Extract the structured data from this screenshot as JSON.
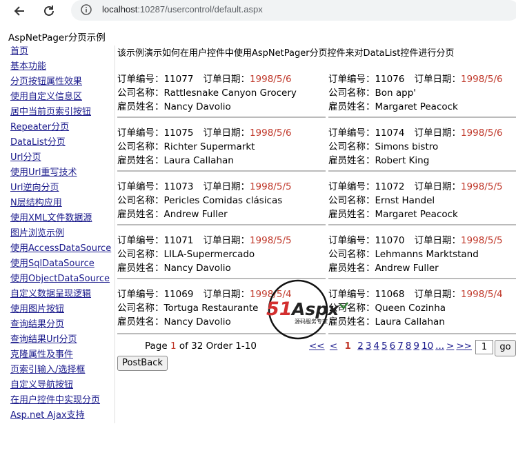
{
  "browser": {
    "url_host": "localhost",
    "url_path": ":10287/usercontrol/default.aspx"
  },
  "page_title": "AspNetPager分页示例",
  "sidebar": {
    "items": [
      {
        "label": "首页"
      },
      {
        "label": "基本功能"
      },
      {
        "label": "分页按钮属性效果"
      },
      {
        "label": "使用自定义信息区"
      },
      {
        "label": "居中当前页索引按钮"
      },
      {
        "label": "Repeater分页"
      },
      {
        "label": "DataList分页"
      },
      {
        "label": "Url分页"
      },
      {
        "label": "使用Url重写技术"
      },
      {
        "label": "Url逆向分页"
      },
      {
        "label": "N层结构应用"
      },
      {
        "label": "使用XML文件数据源"
      },
      {
        "label": "图片浏览示例"
      },
      {
        "label": "使用AccessDataSource"
      },
      {
        "label": "使用SqlDataSource"
      },
      {
        "label": "使用ObjectDataSource"
      },
      {
        "label": "自定义数据呈现逻辑"
      },
      {
        "label": "使用图片按钮"
      },
      {
        "label": "查询结果分页"
      },
      {
        "label": "查询结果Url分页"
      },
      {
        "label": "克隆属性及事件"
      },
      {
        "label": "页索引输入/选择框"
      },
      {
        "label": "自定义导航按钮"
      },
      {
        "label": "在用户控件中实现分页"
      },
      {
        "label": "Asp.net Ajax支持"
      }
    ]
  },
  "intro": "该示例演示如何在用户控件中使用AspNetPager分页控件来对DataList控件进行分页",
  "labels": {
    "order_no": "订单编号：",
    "order_date": "订单日期：",
    "company": "公司名称：",
    "employee": "雇员姓名："
  },
  "orders": [
    {
      "id": "11077",
      "date": "1998/5/6",
      "company": "Rattlesnake Canyon Grocery",
      "employee": "Nancy Davolio"
    },
    {
      "id": "11076",
      "date": "1998/5/6",
      "company": "Bon app'",
      "employee": "Margaret Peacock"
    },
    {
      "id": "11075",
      "date": "1998/5/6",
      "company": "Richter Supermarkt",
      "employee": "Laura Callahan"
    },
    {
      "id": "11074",
      "date": "1998/5/6",
      "company": "Simons bistro",
      "employee": "Robert King"
    },
    {
      "id": "11073",
      "date": "1998/5/5",
      "company": "Pericles Comidas clásicas",
      "employee": "Andrew Fuller"
    },
    {
      "id": "11072",
      "date": "1998/5/5",
      "company": "Ernst Handel",
      "employee": "Margaret Peacock"
    },
    {
      "id": "11071",
      "date": "1998/5/5",
      "company": "LILA-Supermercado",
      "employee": "Nancy Davolio"
    },
    {
      "id": "11070",
      "date": "1998/5/5",
      "company": "Lehmanns Marktstand",
      "employee": "Andrew Fuller"
    },
    {
      "id": "11069",
      "date": "1998/5/4",
      "company": "Tortuga Restaurante",
      "employee": "Nancy Davolio"
    },
    {
      "id": "11068",
      "date": "1998/5/4",
      "company": "Queen Cozinha",
      "employee": "Laura Callahan"
    }
  ],
  "pager": {
    "info_prefix": "Page ",
    "current_page": "1",
    "info_mid": " of 32  Order 1-10",
    "first": "<<",
    "prev": "<",
    "pages": [
      "2",
      "3",
      "4",
      "5",
      "6",
      "7",
      "8",
      "9",
      "10"
    ],
    "ellipsis": "...",
    "next": ">",
    "last": ">>",
    "input_value": "1",
    "go_label": "go"
  },
  "postback_label": "PostBack",
  "watermark": {
    "text": "51Aspx",
    "subtext": "源码服务专家"
  },
  "colors": {
    "date": "#c0392b",
    "link": "#1a1a8c"
  }
}
